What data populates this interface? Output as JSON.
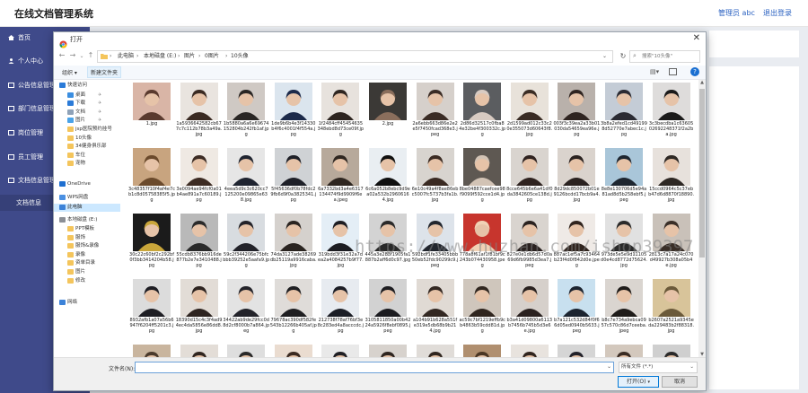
{
  "app": {
    "title": "在线文档管理系统",
    "user": "管理员 abc",
    "logout": "退出登录"
  },
  "sidebar": {
    "items": [
      {
        "label": "首页",
        "icon": "home-icon"
      },
      {
        "label": "个人中心",
        "icon": "user-icon"
      },
      {
        "label": "公告信息管理",
        "icon": "notice-icon"
      },
      {
        "label": "部门信息管理",
        "icon": "department-icon"
      },
      {
        "label": "岗位管理",
        "icon": "position-icon"
      },
      {
        "label": "员工管理",
        "icon": "employee-icon"
      },
      {
        "label": "文档信息管理",
        "icon": "document-icon"
      }
    ],
    "sub_items": [
      {
        "label": "文档信息"
      }
    ]
  },
  "dialog": {
    "title": "打开",
    "address": {
      "breadcrumbs": [
        "此电脑",
        "本地磁盘 (E:)",
        "图片",
        "0图片",
        "10头像"
      ]
    },
    "search_placeholder": "搜索\"10头像\"",
    "toolbar": {
      "organize": "组织 ▾",
      "new_folder": "新建文件夹"
    },
    "nav": {
      "items": [
        {
          "label": "快速访问",
          "indent": 0,
          "icon": "star-icon",
          "selected": false
        },
        {
          "label": "桌面",
          "indent": 1,
          "icon": "desktop-icon",
          "selected": false
        },
        {
          "label": "下载",
          "indent": 1,
          "icon": "download-icon",
          "selected": false
        },
        {
          "label": "文档",
          "indent": 1,
          "icon": "document-icon",
          "selected": false
        },
        {
          "label": "图片",
          "indent": 1,
          "icon": "picture-icon",
          "selected": false
        },
        {
          "label": "jsp医院预约挂号",
          "indent": 1,
          "icon": "folder-icon",
          "selected": false
        },
        {
          "label": "10头像",
          "indent": 1,
          "icon": "folder-icon",
          "selected": false
        },
        {
          "label": "34健身俱乐部",
          "indent": 1,
          "icon": "folder-icon",
          "selected": false
        },
        {
          "label": "车位",
          "indent": 1,
          "icon": "folder-icon",
          "selected": false
        },
        {
          "label": "宠物",
          "indent": 1,
          "icon": "folder-icon",
          "selected": false
        },
        {
          "label": "OneDrive",
          "indent": 0,
          "icon": "cloud-icon",
          "selected": false
        },
        {
          "label": "WPS网盘",
          "indent": 0,
          "icon": "wps-cloud-icon",
          "selected": false
        },
        {
          "label": "此电脑",
          "indent": 0,
          "icon": "computer-icon",
          "selected": true
        },
        {
          "label": "本地磁盘 (E:)",
          "indent": 0,
          "icon": "drive-icon",
          "selected": false
        },
        {
          "label": "PPT模板",
          "indent": 1,
          "icon": "folder-icon",
          "selected": false
        },
        {
          "label": "服饰",
          "indent": 1,
          "icon": "folder-icon",
          "selected": false
        },
        {
          "label": "服饰&录像",
          "indent": 1,
          "icon": "folder-icon",
          "selected": false
        },
        {
          "label": "录像",
          "indent": 1,
          "icon": "folder-icon",
          "selected": false
        },
        {
          "label": "资单目录",
          "indent": 1,
          "icon": "folder-icon",
          "selected": false
        },
        {
          "label": "图片",
          "indent": 1,
          "icon": "folder-icon",
          "selected": false
        },
        {
          "label": "修改",
          "indent": 1,
          "icon": "folder-icon",
          "selected": false
        },
        {
          "label": "网络",
          "indent": 0,
          "icon": "network-icon",
          "selected": false
        }
      ]
    },
    "files": [
      {
        "name": "1.jpg",
        "bg": "#d9b5a6",
        "fg": "#5a3a2e"
      },
      {
        "name": "1a5936642582cb677c7c112b78b3a49a.jpg",
        "bg": "#e9e4df",
        "fg": "#3a2a22"
      },
      {
        "name": "1b5880a6a6e69674152804b242fb1af.jpg",
        "bg": "#cfc9c4",
        "fg": "#2a2624"
      },
      {
        "name": "1de9b6b4e3f14330b4f6c4001f4f554a.jpg",
        "bg": "#dbe5ee",
        "fg": "#1c2a4a"
      },
      {
        "name": "1f2484cff45454635348ebd8d73ce09f.jpg",
        "bg": "#e7e2dd",
        "fg": "#2e2520"
      },
      {
        "name": "2.jpg",
        "bg": "#3b3936",
        "fg": "#8a6e5c"
      },
      {
        "name": "2a6ebb663d86e2e2e5f7450fcad368e3.jpeg",
        "bg": "#d6d0cb",
        "fg": "#3b2c25"
      },
      {
        "name": "2d86d32517c0fba84e32be4f300332c.jpg",
        "bg": "#5b5d60",
        "fg": "#d8cbc2"
      },
      {
        "name": "2d1599ad012c33c20e355073d60643f8.jpg",
        "bg": "#e8e2da",
        "fg": "#3a2c24"
      },
      {
        "name": "003f3c39ea2a33b01030da54659ea96e.jpg",
        "bg": "#b9b1ab",
        "fg": "#2f2420"
      },
      {
        "name": "3b8a2efed1cd491998d52770e7abec1c.jpg",
        "bg": "#c4ccd6",
        "fg": "#2b2b33"
      },
      {
        "name": "3c3becdba1c6360502692248371f2a2ba.jpg",
        "bg": "#dedcdb",
        "fg": "#1b1a1a"
      },
      {
        "name": "3c48357f10f4af4e7cb1c8d05758385f5.jpg",
        "bg": "#c8a47f",
        "fg": "#6b4a2c"
      },
      {
        "name": "3e0094ae94fcf0a01b4ae891a7c60189.jpg",
        "bg": "#efe9e3",
        "fg": "#3d2c24"
      },
      {
        "name": "4eea5d9c3c620cc7125200e09865e638.jpg",
        "bg": "#e6e6e6",
        "fg": "#1f2430"
      },
      {
        "name": "5f45636df0b78fdc29fb6d9f0a3825341.jpg",
        "bg": "#cfd2d5",
        "fg": "#1e2028"
      },
      {
        "name": "6a7332bd3a4e6317134474f9d9909f6ea.jpeg",
        "bg": "#b7a99b",
        "fg": "#2e2620"
      },
      {
        "name": "6c6a052b8ebc9d9ea02a532b29606164.jpg",
        "bg": "#e9eef2",
        "fg": "#101010"
      },
      {
        "name": "6e10c49a4f8ae86ebc5007fc5737b3fa1b.jpg",
        "bg": "#d8d4cf",
        "fg": "#3a2a22"
      },
      {
        "name": "8be04887caefcee98f9099f592cce1d4.jpg",
        "bg": "#5e5852",
        "fg": "#d2c3b5"
      },
      {
        "name": "8cce645b6e6a41df0da3842605ce138d.jpg",
        "bg": "#d9d4cf",
        "fg": "#2f2320"
      },
      {
        "name": "8d29dc850072b01e9126bcdd17bcb9a4.jpg",
        "bg": "#dad3cd",
        "fg": "#2a2220"
      },
      {
        "name": "8e8e130706d5e94a81ad8d5b258ebf5.jpeg",
        "bg": "#a9c6d9",
        "fg": "#1e2630"
      },
      {
        "name": "15ccd0964c5c37ebb47d6d8870f18890.jpg",
        "bg": "#e7e1dc",
        "fg": "#2e2824"
      },
      {
        "name": "30c22c60bf2c292bf0f3bb3414204b58.jpg",
        "bg": "#1b1b1b",
        "fg": "#c9a63a"
      },
      {
        "name": "55cdb8376bb916de877b2e7e3410488.jpg",
        "bg": "#b9b9b9",
        "fg": "#2a2a2a"
      },
      {
        "name": "59c2f344206e75bfcbbb39252e5aafa9.jpg",
        "bg": "#d8dce0",
        "fg": "#23232a"
      },
      {
        "name": "74da3127ade38269db25119a9916caba.jpg",
        "bg": "#d5d1cd",
        "fg": "#2a2420"
      },
      {
        "name": "319bdd3f31e32a7dea2a4084257b9f77.jpg",
        "bg": "#e4eef6",
        "fg": "#1d1d22"
      },
      {
        "name": "445a3e283f1905fa1887b2aff6d0c97.jpg",
        "bg": "#d3d3d3",
        "fg": "#2a2a2a"
      },
      {
        "name": "592bdf1fe33405bbb50eb52fdc90299c9.jpeg",
        "bg": "#dde3ea",
        "fg": "#22262e"
      },
      {
        "name": "778a8f61af1f81bf9c243b074430958.jpeg",
        "bg": "#c7352d",
        "fg": "#f0d2b6"
      },
      {
        "name": "827e0e1db6d57d0a69d6fb9985d3ea7.jpeg",
        "bg": "#d9d4cf",
        "fg": "#2a2220"
      },
      {
        "name": "887ac1ef5a7c93464b23f4d0f842d0e.jpeg",
        "bg": "#efeae6",
        "fg": "#30241e"
      },
      {
        "name": "973de5e5e9d11105d0e4cd8772d75624.jpg",
        "bg": "#e1e1e1",
        "fg": "#2a2a2a"
      },
      {
        "name": "2813c7a17a24c070d49927b308a05b4e.jpg",
        "bg": "#c9c1b9",
        "fg": "#3a2f28"
      },
      {
        "name": "8932afb1a07a56b6947f6204ff5201c3.jpg",
        "bg": "#dcdcdc",
        "fg": "#1e1e24"
      },
      {
        "name": "18390d15c4c3f4ad94ec4da5856e86dd8.jpg",
        "bg": "#e2dcd6",
        "fg": "#2e2420"
      },
      {
        "name": "34422ab9de29fcc0d8d2cf8000b7a864.jpeg",
        "bg": "#e3e3e3",
        "fg": "#23232a"
      },
      {
        "name": "79678ac390df582fe543b12266b405af.jpg",
        "bg": "#dfdcd9",
        "fg": "#1f1f22"
      },
      {
        "name": "212738f78af76bf3e8c283ed4a8acccdc.jpg",
        "bg": "#e7ebf0",
        "fg": "#1c1e26"
      },
      {
        "name": "3105811850a00b4224a5926f8ebf0895.jpeg",
        "bg": "#d2d2d2",
        "fg": "#1c1c20"
      },
      {
        "name": "a104b91b628a551fe319e5db68b9b214.jpg",
        "bg": "#e0dad4",
        "fg": "#332822"
      },
      {
        "name": "ac59c7bf1219effb9cb4863b59cdd81d.jpg",
        "bg": "#cfc6bc",
        "fg": "#30261f"
      },
      {
        "name": "b3a41d09800a6113b7456b745b5d3e6e.jpg",
        "bg": "#d6d0cb",
        "fg": "#2a2220"
      },
      {
        "name": "b7a121c532d84f0f66d05ed0940b5633.jpeg",
        "bg": "#c8e0ef",
        "fg": "#1c2430"
      },
      {
        "name": "b8c7e734a9ebca0957c570c86d7ceeba.jpeg",
        "bg": "#dad5d0",
        "fg": "#1f1c1a"
      },
      {
        "name": "b2607a2521a9345eda229483b2f88318.jpg",
        "bg": "#d8c49a",
        "fg": "#6b5a3a"
      },
      {
        "name": "",
        "bg": "#c9b59e",
        "fg": "#4a3a2c"
      },
      {
        "name": "",
        "bg": "#e3ddd7",
        "fg": "#30251f"
      },
      {
        "name": "",
        "bg": "#dedede",
        "fg": "#2a2a2a"
      },
      {
        "name": "",
        "bg": "#eadcd0",
        "fg": "#3a2a22"
      },
      {
        "name": "",
        "bg": "#e9e9e9",
        "fg": "#1f1f24"
      },
      {
        "name": "",
        "bg": "#d7d2cd",
        "fg": "#2e2520"
      },
      {
        "name": "",
        "bg": "#e0dcd8",
        "fg": "#30261f"
      },
      {
        "name": "",
        "bg": "#b08f6f",
        "fg": "#4a3624"
      },
      {
        "name": "",
        "bg": "#e8e3de",
        "fg": "#30241e"
      },
      {
        "name": "",
        "bg": "#d5d5d5",
        "fg": "#22222a"
      },
      {
        "name": "",
        "bg": "#d3c8bd",
        "fg": "#3a2c24"
      },
      {
        "name": "",
        "bg": "#cfcfcf",
        "fg": "#2a2a2a"
      }
    ],
    "filename_label": "文件名(N):",
    "filename_value": "",
    "filetype": "所有文件 (*.*)",
    "open_button": "打开(O)",
    "cancel_button": "取消"
  },
  "watermark": "https://www.huzhan.com/ishop39397",
  "colors": {
    "sidebar": "#3f4a8a",
    "accent": "#0078d7"
  }
}
